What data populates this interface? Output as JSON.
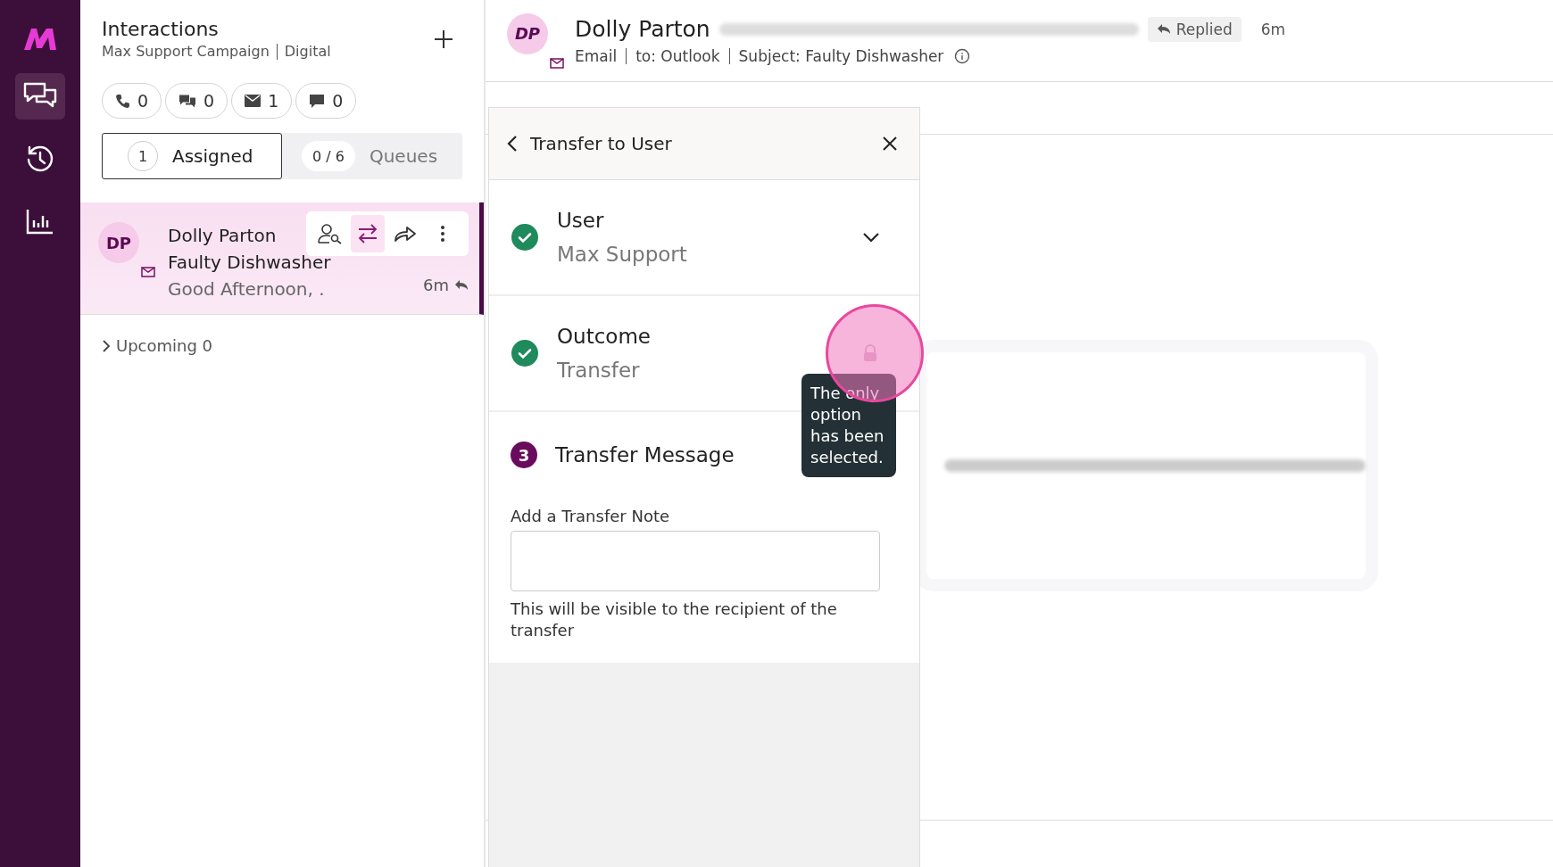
{
  "nav": {
    "items": [
      {
        "kind": "chat",
        "selected": true
      },
      {
        "kind": "history",
        "selected": false
      },
      {
        "kind": "reports",
        "selected": false
      }
    ]
  },
  "interactions": {
    "title": "Interactions",
    "subtitle": "Max Support Campaign",
    "channel": "Digital",
    "counters": [
      {
        "kind": "phone",
        "count": "0"
      },
      {
        "kind": "chat",
        "count": "0"
      },
      {
        "kind": "email",
        "count": "1"
      },
      {
        "kind": "sms",
        "count": "0"
      }
    ],
    "tabs": [
      {
        "count": "1",
        "label": "Assigned",
        "selected": true
      },
      {
        "count": "0 / 6",
        "label": "Queues",
        "selected": false
      }
    ],
    "items": [
      {
        "initials": "DP",
        "name": "Dolly Parton",
        "subject": "Faulty Dishwasher",
        "preview": "Good Afternoon, .",
        "time": "6m",
        "selected": true,
        "actions": [
          {
            "kind": "assign",
            "selected": false
          },
          {
            "kind": "transfer",
            "selected": true
          },
          {
            "kind": "forward",
            "selected": false
          },
          {
            "kind": "more",
            "selected": false
          }
        ]
      }
    ],
    "upcoming": {
      "label": "Upcoming 0",
      "expanded": false
    }
  },
  "header": {
    "initials": "DP",
    "name": "Dolly Parton",
    "status": "Replied",
    "time": "6m",
    "meta": [
      "Email",
      "to: Outlook",
      "Subject: Faulty Dishwasher"
    ]
  },
  "transfer": {
    "title": "Transfer to User",
    "steps": [
      {
        "kind": "dropdown",
        "done": true,
        "title": "User",
        "value": "Max Support"
      },
      {
        "kind": "locked",
        "done": true,
        "title": "Outcome",
        "value": "Transfer"
      },
      {
        "kind": "message",
        "done": false,
        "number": "3",
        "title": "Transfer Message"
      }
    ],
    "tooltip": "The only option has been selected.",
    "note": {
      "label": "Add a Transfer Note",
      "help": "This will be visible to the recipient of the transfer"
    }
  }
}
